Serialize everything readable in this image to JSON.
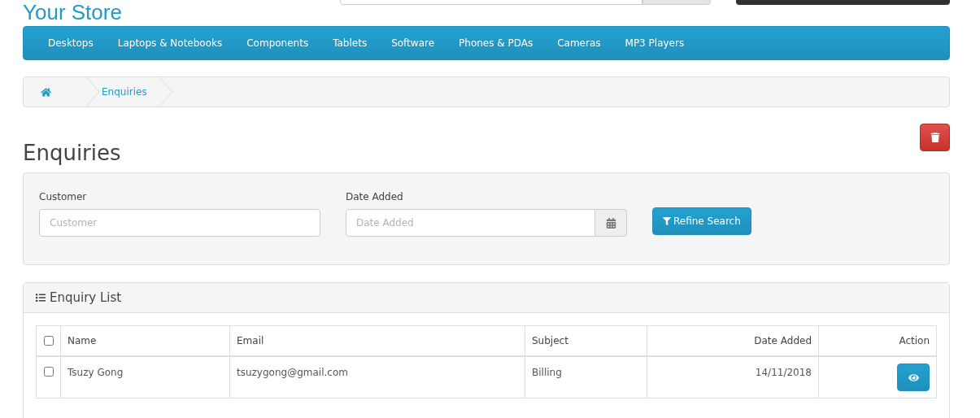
{
  "logo": "Your Store",
  "menu": [
    {
      "label": "Desktops"
    },
    {
      "label": "Laptops & Notebooks"
    },
    {
      "label": "Components"
    },
    {
      "label": "Tablets"
    },
    {
      "label": "Software"
    },
    {
      "label": "Phones & PDAs"
    },
    {
      "label": "Cameras"
    },
    {
      "label": "MP3 Players"
    }
  ],
  "breadcrumb": [
    {
      "kind": "home"
    },
    {
      "kind": "link",
      "label": "Enquiries"
    }
  ],
  "title": "Enquiries",
  "filters": [
    {
      "kind": "text",
      "label": "Customer",
      "placeholder": "Customer"
    },
    {
      "kind": "date",
      "label": "Date Added",
      "placeholder": "Date Added"
    }
  ],
  "refine_button": "Refine Search",
  "list_title": "Enquiry List",
  "table": {
    "columns": [
      {
        "label": "Name"
      },
      {
        "label": "Email"
      },
      {
        "label": "Subject"
      },
      {
        "label": "Date Added"
      },
      {
        "label": "Action"
      }
    ],
    "all_checked": false,
    "rows": [
      {
        "checked": false,
        "cells": [
          "Tsuzy Gong",
          "tsuzygong@gmail.com",
          "Billing",
          "14/11/2018"
        ]
      }
    ]
  }
}
